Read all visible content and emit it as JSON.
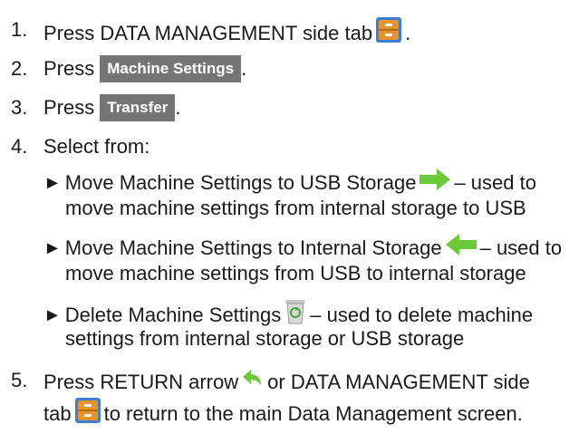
{
  "steps": [
    {
      "num": "1.",
      "text": "Press DATA MANAGEMENT side tab",
      "after": "."
    },
    {
      "num": "2.",
      "text": "Press",
      "button": "Machine Settings",
      "after": "."
    },
    {
      "num": "3.",
      "text": "Press",
      "button": "Transfer",
      "after": "."
    },
    {
      "num": "4.",
      "text": "Select from:"
    },
    {
      "num": "5.",
      "line1_a": "Press RETURN arrow",
      "line1_b": "or DATA MANAGEMENT side",
      "line2_a": "tab",
      "line2_b": "to return to the main Data Management screen."
    }
  ],
  "options": [
    {
      "bullet": "►",
      "line1_a": "Move Machine Settings to USB Storage",
      "line1_b": "– used to",
      "line2": "move machine settings from internal storage to USB",
      "icon": "arrow-right-green-icon"
    },
    {
      "bullet": "►",
      "line1_a": "Move Machine Settings to Internal Storage",
      "line1_b": "– used to",
      "line2": "move machine settings from USB to internal storage",
      "icon": "arrow-left-green-icon"
    },
    {
      "bullet": "►",
      "line1_a": "Delete Machine Settings",
      "line1_b": "– used to delete machine",
      "line2": "settings from internal storage or USB storage",
      "icon": "recycle-bin-icon"
    }
  ],
  "colors": {
    "button_bg": "#757575",
    "button_text": "#ffffff",
    "arrow_green": "#6cc93a",
    "drawer_orange": "#e8932a"
  }
}
